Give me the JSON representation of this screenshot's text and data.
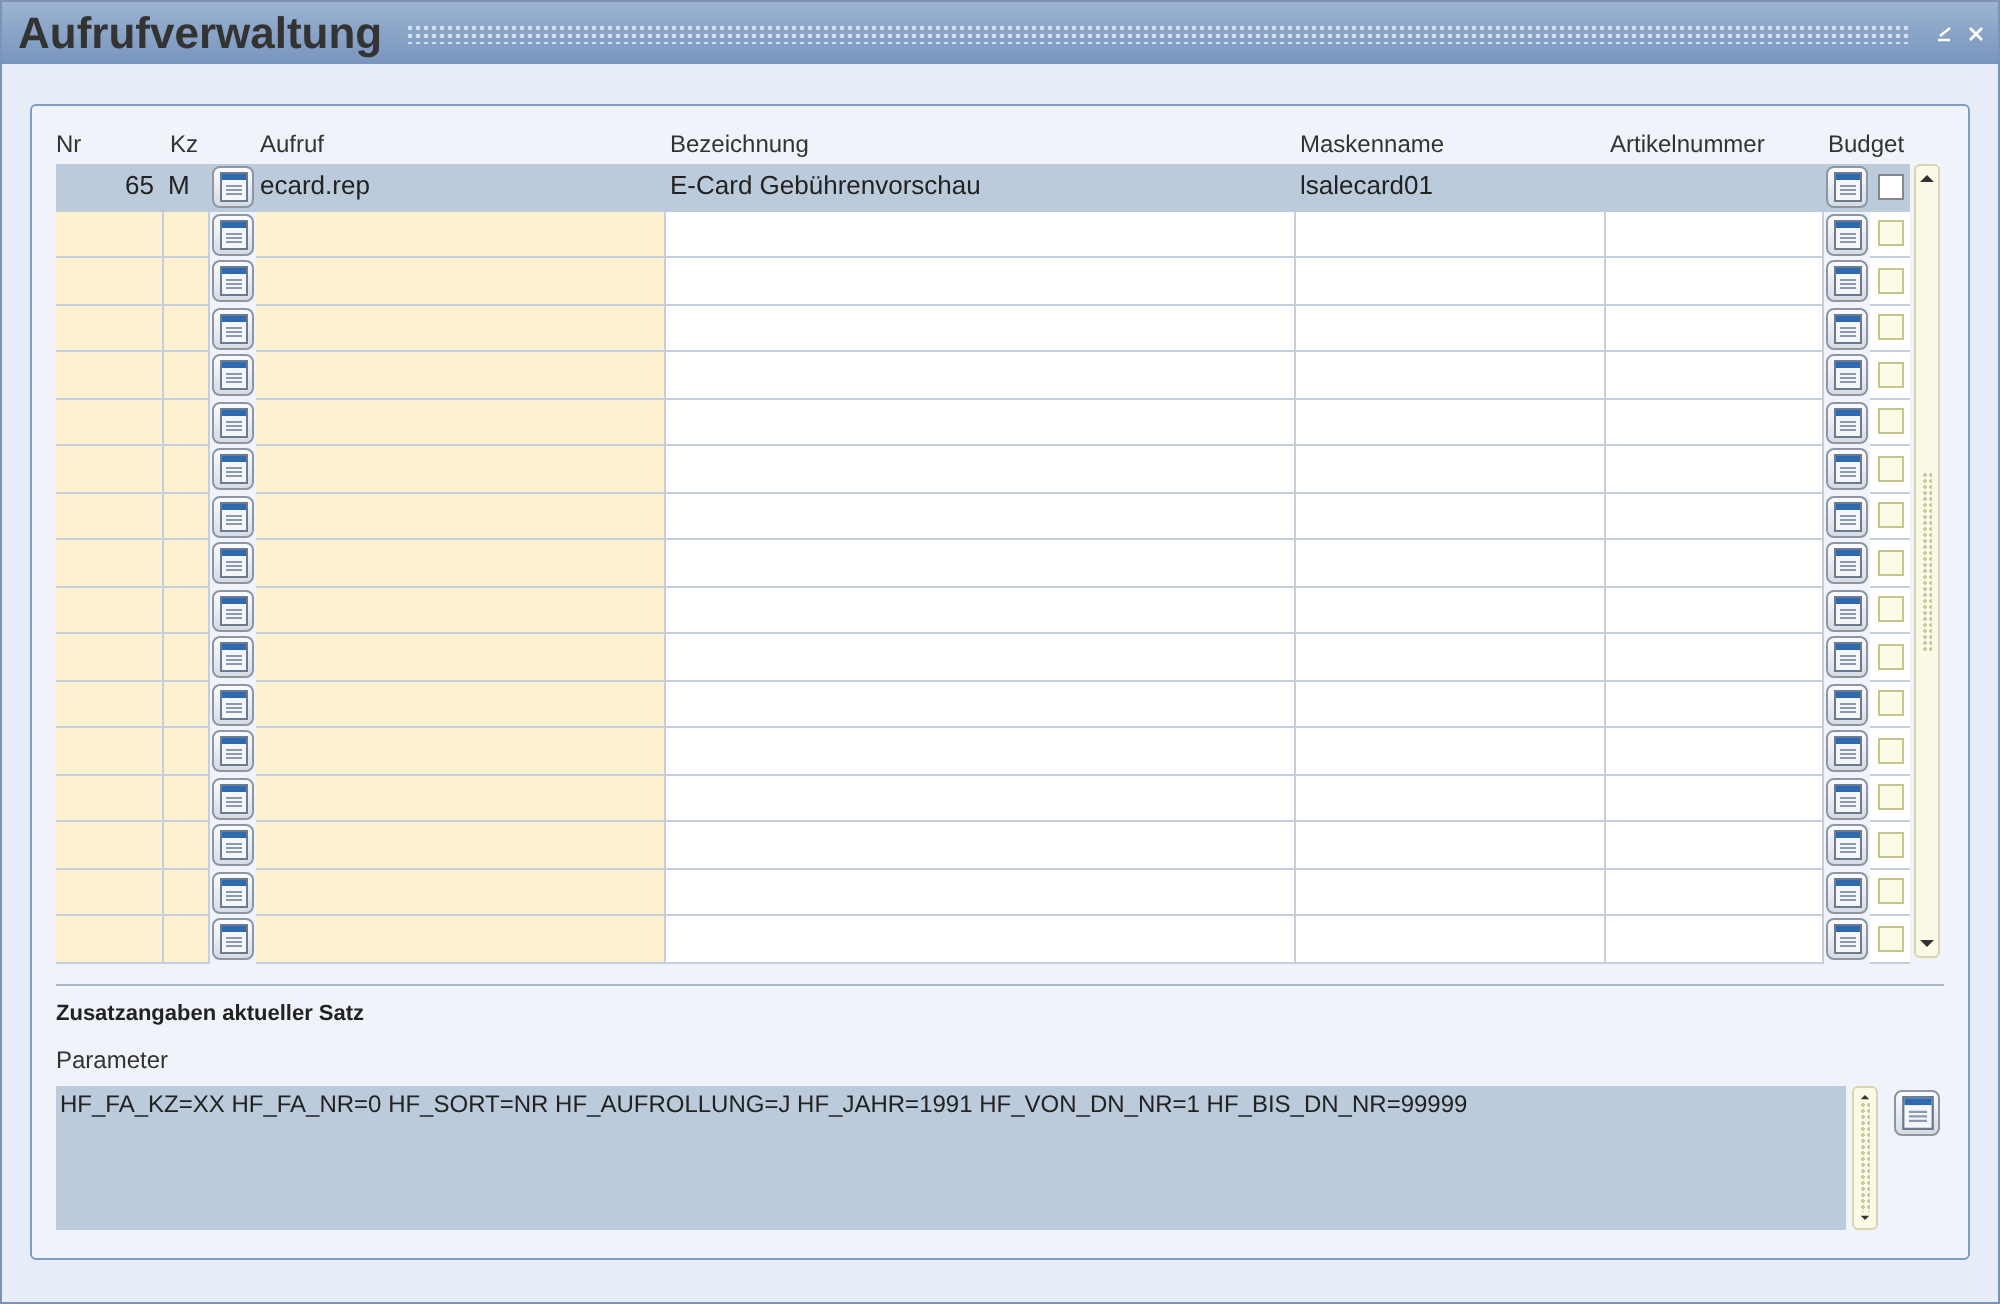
{
  "window": {
    "title": "Aufrufverwaltung"
  },
  "table": {
    "columns": [
      "Nr",
      "Kz",
      "Aufruf",
      "Bezeichnung",
      "Maskenname",
      "Artikelnummer",
      "Budget"
    ],
    "rows": [
      {
        "nr": "65",
        "kz": "M",
        "aufruf": "ecard.rep",
        "bezeichnung": "E-Card Gebührenvorschau",
        "maskenname": "lsalecard01",
        "selected": true,
        "budget_checked": false
      },
      {
        "selected": false,
        "budget_checked": false
      },
      {
        "selected": false,
        "budget_checked": false
      },
      {
        "selected": false,
        "budget_checked": false
      },
      {
        "selected": false,
        "budget_checked": false
      },
      {
        "selected": false,
        "budget_checked": false
      },
      {
        "selected": false,
        "budget_checked": false
      },
      {
        "selected": false,
        "budget_checked": false
      },
      {
        "selected": false,
        "budget_checked": false
      },
      {
        "selected": false,
        "budget_checked": false
      },
      {
        "selected": false,
        "budget_checked": false
      },
      {
        "selected": false,
        "budget_checked": false
      },
      {
        "selected": false,
        "budget_checked": false
      },
      {
        "selected": false,
        "budget_checked": false
      },
      {
        "selected": false,
        "budget_checked": false
      },
      {
        "selected": false,
        "budget_checked": false
      },
      {
        "selected": false,
        "budget_checked": false
      }
    ]
  },
  "details": {
    "heading": "Zusatzangaben aktueller Satz",
    "parameter_label": "Parameter",
    "parameter_value": "HF_FA_KZ=XX HF_FA_NR=0 HF_SORT=NR HF_AUFROLLUNG=J HF_JAHR=1991 HF_VON_DN_NR=1 HF_BIS_DN_NR=99999"
  }
}
